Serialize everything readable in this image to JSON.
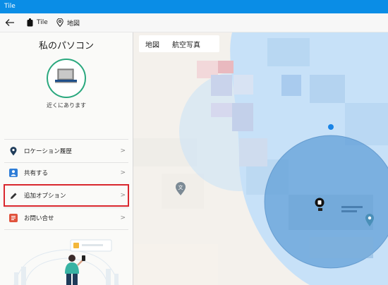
{
  "app": {
    "title": "Tile"
  },
  "nav": {
    "crumb1": "Tile",
    "crumb2": "地図"
  },
  "device": {
    "name": "私のパソコン",
    "status": "近くにあります"
  },
  "menu": [
    {
      "label": "ロケーション履歴",
      "icon": "location-pin-icon"
    },
    {
      "label": "共有する",
      "icon": "person-icon"
    },
    {
      "label": "追加オプション",
      "icon": "pencil-icon"
    },
    {
      "label": "お問い合せ",
      "icon": "help-chat-icon"
    }
  ],
  "map": {
    "tabs": [
      "地図",
      "航空写真"
    ]
  },
  "colors": {
    "titlebar": "#0a8de6",
    "accent": "#2aa87e",
    "highlight": "#d9272e",
    "location_circle": "#5b9bd5"
  }
}
